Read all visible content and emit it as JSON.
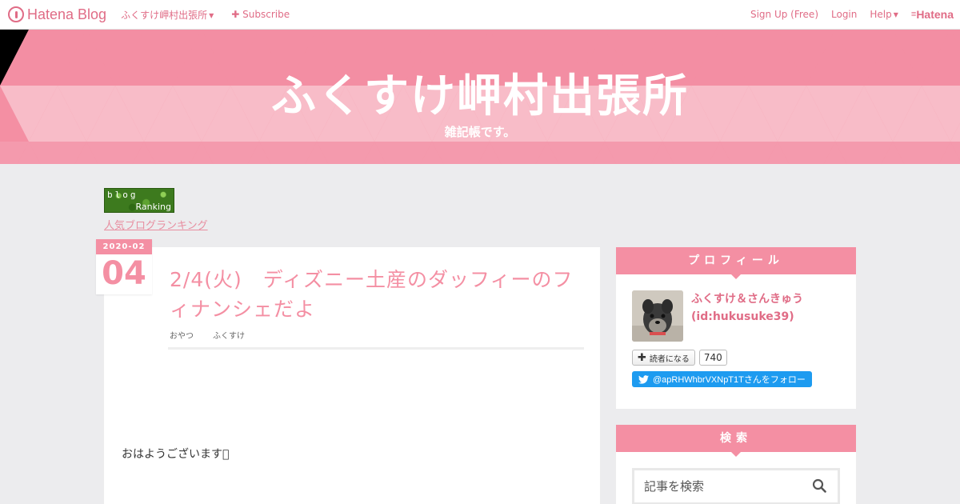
{
  "globalbar": {
    "logo_text": "Hatena Blog",
    "blog_menu": "ふくすけ岬村出張所",
    "subscribe": "Subscribe",
    "signup": "Sign Up (Free)",
    "login": "Login",
    "help": "Help",
    "hatena": "Hatena"
  },
  "header": {
    "title": "ふくすけ岬村出張所",
    "description": "雑記帳です。"
  },
  "ranking": {
    "banner_line1": "blog",
    "banner_line2": "Ranking",
    "link_text": "人気ブログランキング"
  },
  "entry": {
    "date_ym": "2020-02",
    "date_day": "04",
    "title": "2/4(火)　ディズニー土産のダッフィーのフィナンシェだよ",
    "category": "おやつ",
    "author": "ふくすけ",
    "body_first_line": "おはようございます󾌧"
  },
  "sidebar": {
    "profile": {
      "heading": "プロフィール",
      "name": "ふくすけ＆さんきゅう",
      "id": "(id:hukusuke39)",
      "reader_button": "読者になる",
      "reader_count": "740",
      "twitter_follow": "@apRHWhbrVXNpT1Tさんをフォロー"
    },
    "search": {
      "heading": "検索",
      "placeholder": "記事を検索"
    }
  },
  "colors": {
    "accent": "#f48fa3",
    "link": "#e06c86",
    "page_bg": "#ececee",
    "twitter": "#1d9bf0"
  }
}
